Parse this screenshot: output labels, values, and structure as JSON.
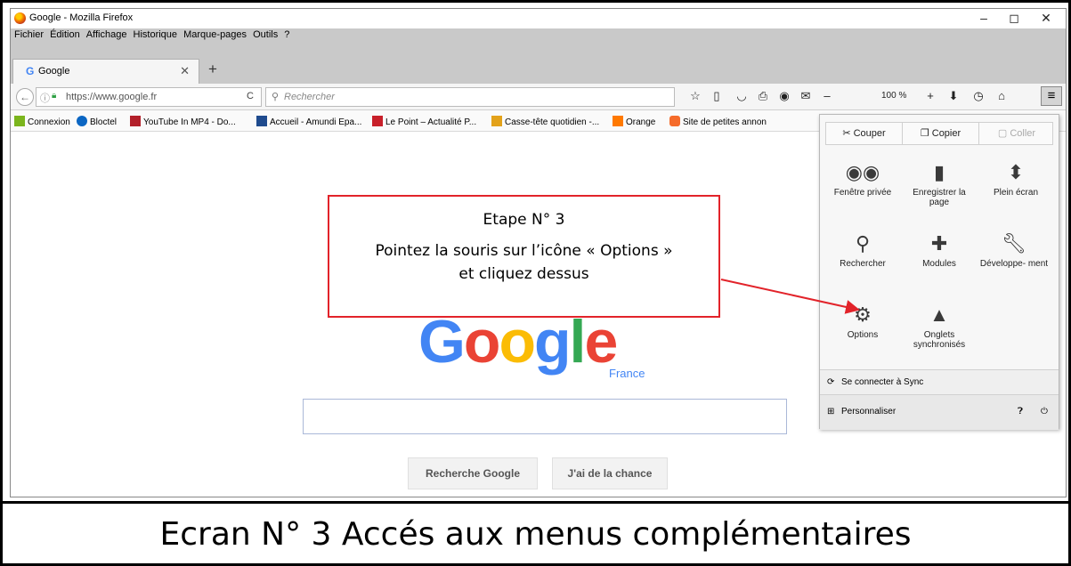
{
  "window": {
    "title": "Google - Mozilla Firefox",
    "minimize": "–",
    "maximize": "◻",
    "close": "✕"
  },
  "menubar": [
    "Fichier",
    "Édition",
    "Affichage",
    "Historique",
    "Marque-pages",
    "Outils",
    "?"
  ],
  "tab": {
    "label": "Google",
    "close": "✕",
    "new": "+"
  },
  "navbar": {
    "url": "https://www.google.fr",
    "search_placeholder": "Rechercher",
    "zoom": "100 %",
    "zoom_minus": "–",
    "zoom_plus": "+"
  },
  "bookmarks": [
    {
      "label": "Connexion",
      "color": "#7bb51d"
    },
    {
      "label": "Bloctel",
      "color": "#0b66c3"
    },
    {
      "label": "YouTube In MP4 - Do...",
      "color": "#b3202a"
    },
    {
      "label": "Accueil - Amundi Epa...",
      "color": "#1f4b8e"
    },
    {
      "label": "Le Point – Actualité P...",
      "color": "#c8202a"
    },
    {
      "label": "Casse-tête quotidien -...",
      "color": "#e3a21a"
    },
    {
      "label": "Orange",
      "color": "#ff7900"
    },
    {
      "label": "Site de petites annon",
      "color": "#f56b2a"
    }
  ],
  "page": {
    "logo": [
      "G",
      "o",
      "o",
      "g",
      "l",
      "e"
    ],
    "logo_colors": [
      "#4285f4",
      "#ea4335",
      "#fbbc05",
      "#4285f4",
      "#34a853",
      "#ea4335"
    ],
    "country": "France",
    "btn_search": "Recherche Google",
    "btn_lucky": "J'ai de la chance"
  },
  "callout": {
    "title": "Etape N° 3",
    "line1": "Pointez la souris sur l’icône « Options »",
    "line2": "et cliquez dessus"
  },
  "menu": {
    "cut": "Couper",
    "copy": "Copier",
    "paste": "Coller",
    "items": [
      {
        "label": "Fenêtre privée",
        "icon": "mask-icon"
      },
      {
        "label": "Enregistrer la page",
        "icon": "page-icon"
      },
      {
        "label": "Plein écran",
        "icon": "fullscreen-icon"
      },
      {
        "label": "Rechercher",
        "icon": "magnifier-icon"
      },
      {
        "label": "Modules",
        "icon": "puzzle-icon"
      },
      {
        "label": "Développe- ment",
        "icon": "wrench-icon"
      },
      {
        "label": "Options",
        "icon": "gear-icon"
      },
      {
        "label": "Onglets synchronisés",
        "icon": "synced-tabs-icon"
      }
    ],
    "sync": "Se connecter à Sync",
    "customize": "Personnaliser"
  },
  "caption": "Ecran N° 3 Accés aux menus complémentaires"
}
